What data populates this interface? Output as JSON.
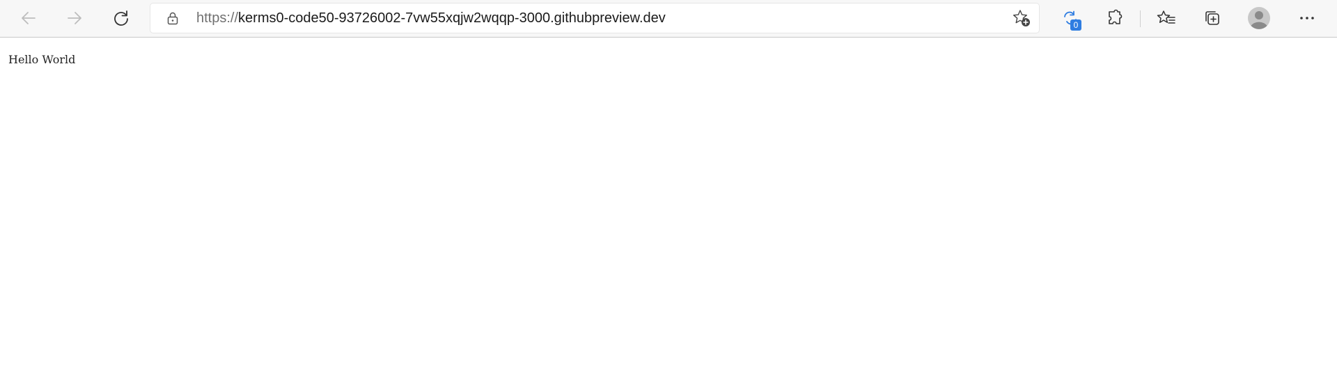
{
  "browser": {
    "url_scheme": "https://",
    "url_rest": "kerms0-code50-93726002-7vw55xqjw2wqqp-3000.githubpreview.dev",
    "badge_count": "0",
    "accent": "#2f7de1",
    "icons": [
      "back-arrow-icon",
      "forward-arrow-icon",
      "refresh-icon",
      "lock-icon",
      "add-favorite-icon",
      "refresh-sync-icon",
      "extensions-icon",
      "favorites-icon",
      "collections-icon",
      "profile-avatar-icon",
      "more-options-icon"
    ]
  },
  "page": {
    "body_text": "Hello World"
  }
}
